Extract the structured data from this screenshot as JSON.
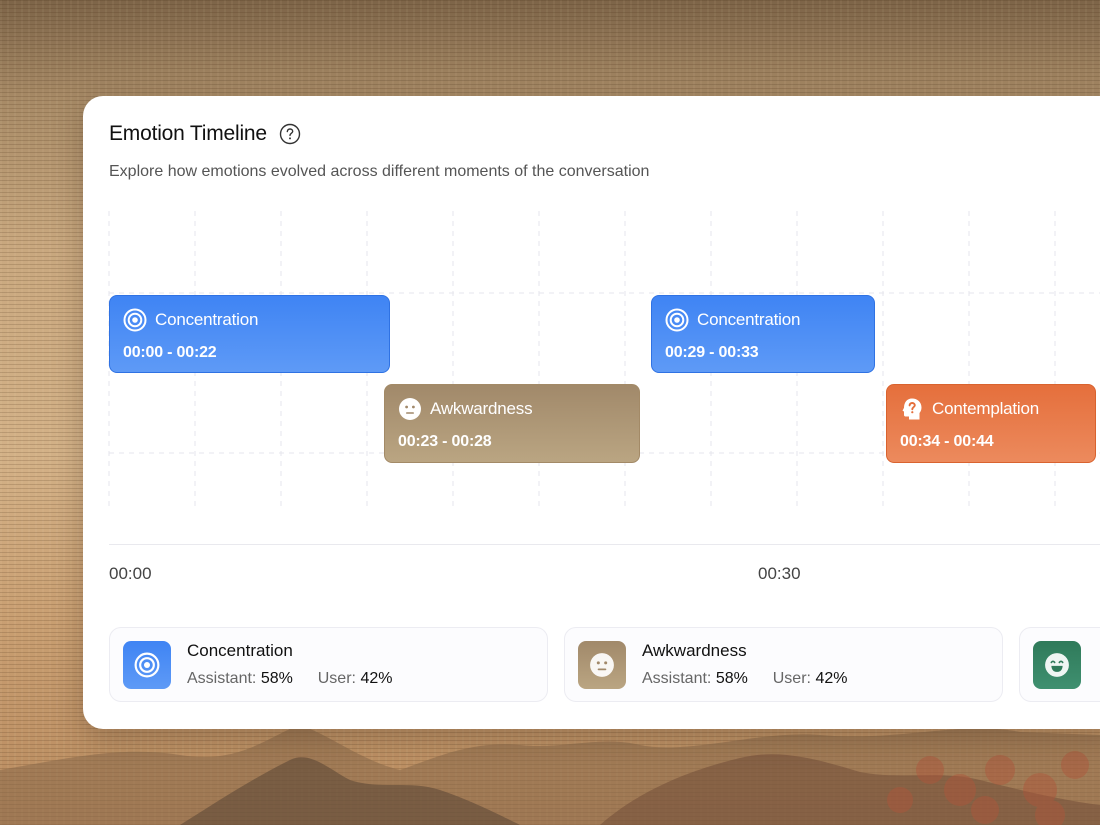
{
  "header": {
    "title": "Emotion Timeline",
    "subtitle": "Explore how emotions evolved across different moments of the conversation"
  },
  "colors": {
    "concentration": "#3f84f4",
    "awkwardness": "#a1896a",
    "contemplation": "#e56f3c",
    "joy": "#2f7a5a"
  },
  "timeline": {
    "segments": [
      {
        "emotion": "Concentration",
        "time": "00:00 - 00:22",
        "icon": "target-icon"
      },
      {
        "emotion": "Awkwardness",
        "time": "00:23 - 00:28",
        "icon": "neutral-face-icon"
      },
      {
        "emotion": "Concentration",
        "time": "00:29 - 00:33",
        "icon": "target-icon"
      },
      {
        "emotion": "Contemplation",
        "time": "00:34 - 00:44",
        "icon": "question-head-icon"
      }
    ],
    "ticks": [
      "00:00",
      "00:30"
    ]
  },
  "legend": {
    "items": [
      {
        "name": "Concentration",
        "assistant_label": "Assistant:",
        "assistant": "58%",
        "user_label": "User:",
        "user": "42%",
        "icon": "target-icon"
      },
      {
        "name": "Awkwardness",
        "assistant_label": "Assistant:",
        "assistant": "58%",
        "user_label": "User:",
        "user": "42%",
        "icon": "neutral-face-icon"
      },
      {
        "icon": "laughing-face-icon"
      }
    ]
  }
}
